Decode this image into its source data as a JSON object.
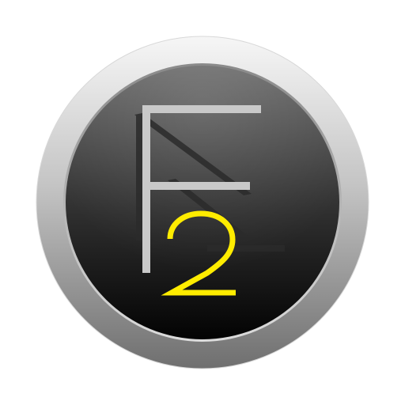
{
  "icon": {
    "name": "F2 app icon",
    "letter": "F",
    "digit": "2",
    "colors": {
      "background": "#ffffff",
      "bezel_light": "#f4f4f4",
      "bezel_mid": "#b8b8b8",
      "bezel_dark": "#7a7a7a",
      "face_top": "#6a6a6a",
      "face_bottom": "#050505",
      "letter": "#c8c8c8",
      "shadow": "#2a2a2a",
      "digit": "#ffec00"
    }
  }
}
